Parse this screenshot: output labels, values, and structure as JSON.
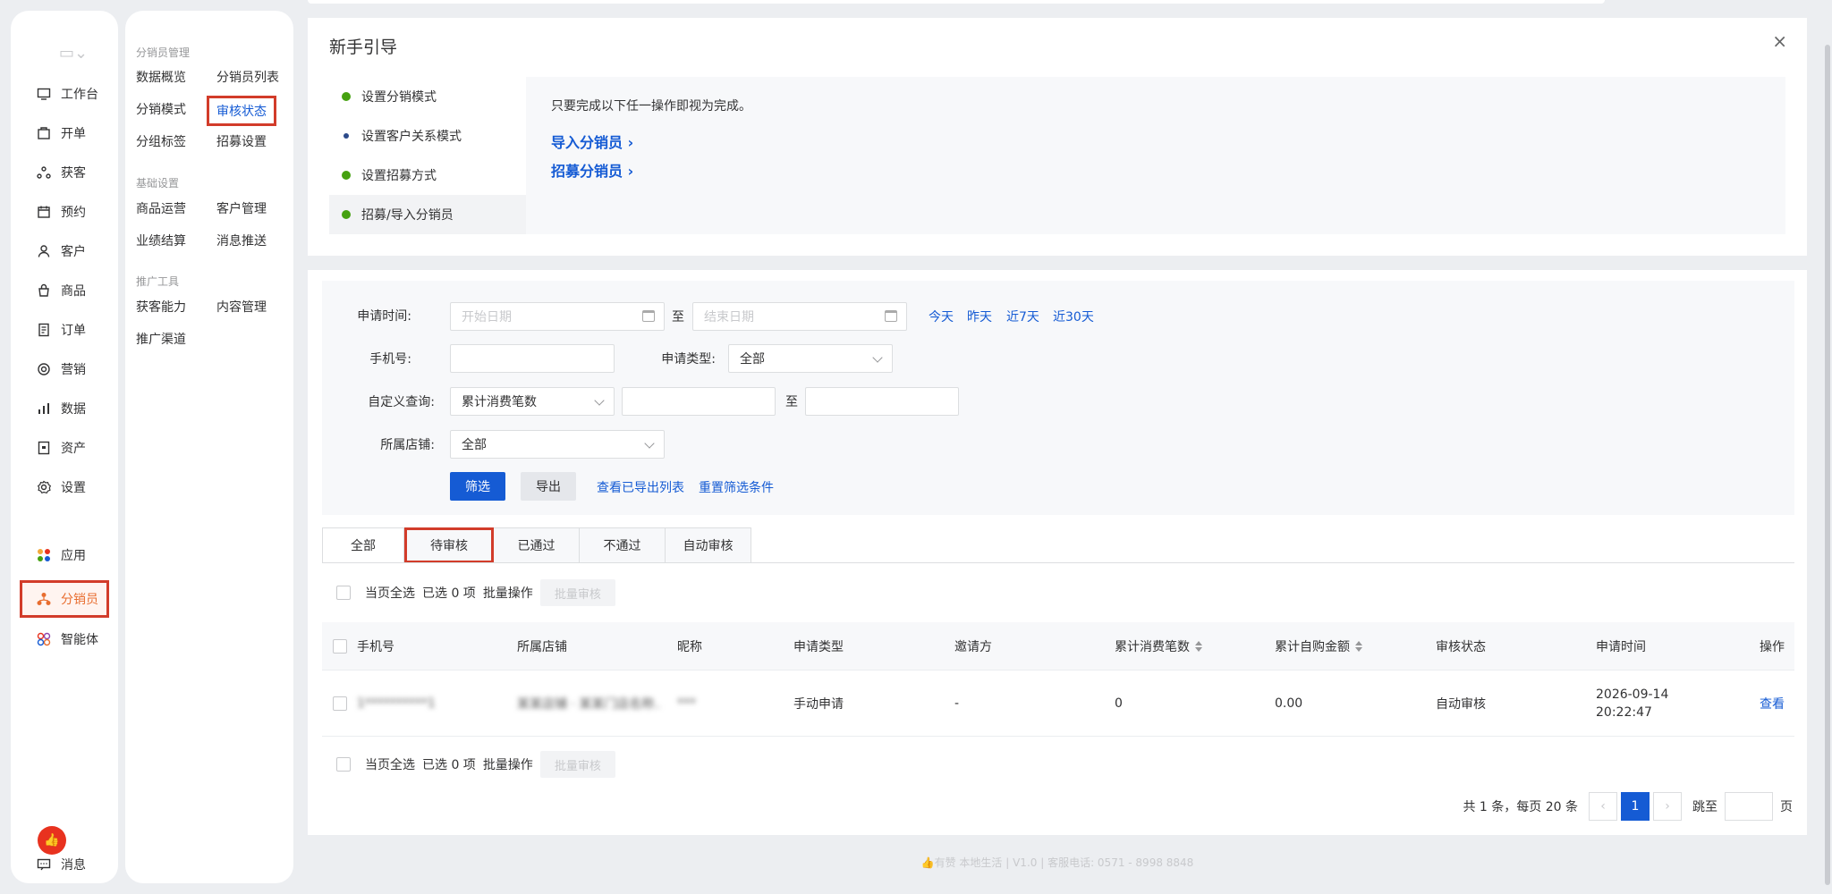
{
  "nav": {
    "items": [
      {
        "label": "工作台",
        "icon": "workbench-icon"
      },
      {
        "label": "开单",
        "icon": "billing-icon"
      },
      {
        "label": "获客",
        "icon": "acquire-icon"
      },
      {
        "label": "预约",
        "icon": "calendar-icon"
      },
      {
        "label": "客户",
        "icon": "user-icon"
      },
      {
        "label": "商品",
        "icon": "bag-icon"
      },
      {
        "label": "订单",
        "icon": "order-icon"
      },
      {
        "label": "营销",
        "icon": "target-icon"
      },
      {
        "label": "数据",
        "icon": "bar-chart-icon"
      },
      {
        "label": "资产",
        "icon": "asset-icon"
      },
      {
        "label": "设置",
        "icon": "gear-icon"
      }
    ],
    "apps": {
      "label": "应用"
    },
    "distributor": {
      "label": "分销员"
    },
    "ai": {
      "label": "智能体"
    },
    "messages": {
      "label": "消息"
    }
  },
  "submenu": {
    "group1": "分销员管理",
    "g1_items": [
      "数据概览",
      "分销员列表",
      "分销模式",
      "审核状态",
      "分组标签",
      "招募设置"
    ],
    "group2": "基础设置",
    "g2_items": [
      "商品运营",
      "客户管理",
      "业绩结算",
      "消息推送"
    ],
    "group3": "推广工具",
    "g3_items": [
      "获客能力",
      "内容管理",
      "推广渠道"
    ]
  },
  "guide": {
    "title": "新手引导",
    "close": "×",
    "steps": [
      "设置分销模式",
      "设置客户关系模式",
      "设置招募方式",
      "招募/导入分销员"
    ],
    "desc": "只要完成以下任一操作即视为完成。",
    "link1": "导入分销员 ›",
    "link2": "招募分销员 ›"
  },
  "filter": {
    "apply_time_label": "申请时间:",
    "start_placeholder": "开始日期",
    "to": "至",
    "end_placeholder": "结束日期",
    "quick": [
      "今天",
      "昨天",
      "近7天",
      "近30天"
    ],
    "phone_label": "手机号:",
    "type_label": "申请类型:",
    "type_value": "全部",
    "custom_label": "自定义查询:",
    "custom_value": "累计消费笔数",
    "store_label": "所属店铺:",
    "store_value": "全部",
    "filter_btn": "筛选",
    "export_btn": "导出",
    "view_export": "查看已导出列表",
    "reset": "重置筛选条件"
  },
  "tabs": [
    "全部",
    "待审核",
    "已通过",
    "不通过",
    "自动审核"
  ],
  "batch": {
    "select_page": "当页全选",
    "selected": "已选 0 项",
    "batch_op": "批量操作",
    "batch_audit": "批量审核"
  },
  "table": {
    "headers": [
      "手机号",
      "所属店铺",
      "昵称",
      "申请类型",
      "邀请方",
      "累计消费笔数",
      "累计自购金额",
      "审核状态",
      "申请时间",
      "操作"
    ],
    "rows": [
      {
        "phone": "1**********1",
        "store": "某某店铺 · 某某门店名称...",
        "nick": "***",
        "type": "手动申请",
        "inviter": "-",
        "count": "0",
        "amount": "0.00",
        "status": "自动审核",
        "date": "2026-09-14",
        "time": "20:22:47",
        "action": "查看"
      }
    ]
  },
  "pager": {
    "summary": "共 1 条，每页 20 条",
    "prev": "‹",
    "page": "1",
    "next": "›",
    "jump": "跳至",
    "unit": "页"
  },
  "footer": "👍有赞 本地生活  |  V1.0  |  客服电话: 0571 - 8998 8848"
}
